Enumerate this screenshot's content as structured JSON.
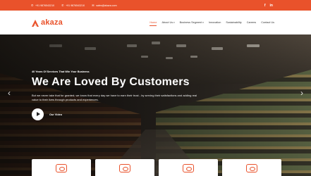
{
  "topbar": {
    "phone1": "+91 9876543210",
    "phone2": "+91 9876543210",
    "email": "sales@akaza.com",
    "social": [
      "f",
      "in"
    ]
  },
  "header": {
    "logo_text": "akaza",
    "brand_color": "#e9522b",
    "nav": [
      {
        "label": "Home",
        "active": true,
        "dropdown": false
      },
      {
        "label": "About Us",
        "active": false,
        "dropdown": true
      },
      {
        "label": "Business Segment",
        "active": false,
        "dropdown": true
      },
      {
        "label": "Innovation",
        "active": false,
        "dropdown": false
      },
      {
        "label": "Sustainability",
        "active": false,
        "dropdown": false
      },
      {
        "label": "Careers",
        "active": false,
        "dropdown": false
      },
      {
        "label": "Contact Us",
        "active": false,
        "dropdown": false
      }
    ]
  },
  "hero": {
    "eyebrow": "40 Years Of Services That Win Your Business",
    "headline": "We Are Loved By Customers",
    "description": "But we never take that for granted; we know that every day we have to earn their trust - by serving their satisfactions and adding real value to their lives through products and experiences.",
    "video_label": "Our Video",
    "prev_arrow": "‹",
    "next_arrow": "›"
  },
  "cards": [
    {
      "icon": "gift-icon"
    },
    {
      "icon": "cart-icon"
    },
    {
      "icon": "handshake-icon"
    },
    {
      "icon": "truck-icon"
    }
  ]
}
